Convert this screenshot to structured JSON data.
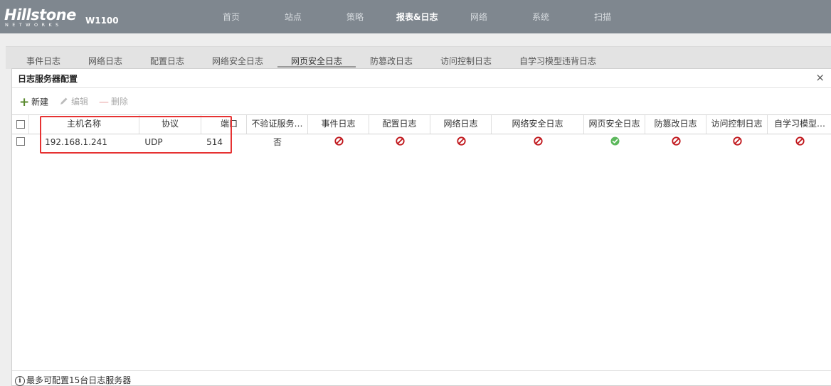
{
  "header": {
    "logo_text": "Hillstone",
    "logo_subtext": "NETWORKS",
    "model": "W1100",
    "nav": [
      "首页",
      "站点",
      "策略",
      "报表&日志",
      "网络",
      "系统",
      "扫描"
    ],
    "active_nav": "报表&日志"
  },
  "tabs": [
    "事件日志",
    "网络日志",
    "配置日志",
    "网络安全日志",
    "网页安全日志",
    "防篡改日志",
    "访问控制日志",
    "自学习模型违背日志"
  ],
  "active_tab": "网页安全日志",
  "panel": {
    "title": "日志服务器配置",
    "close_icon": "×"
  },
  "toolbar": {
    "new_label": "新建",
    "edit_label": "编辑",
    "delete_label": "删除"
  },
  "table": {
    "columns": [
      "主机名称",
      "协议",
      "端口",
      "不验证服务…",
      "事件日志",
      "配置日志",
      "网络日志",
      "网络安全日志",
      "网页安全日志",
      "防篡改日志",
      "访问控制日志",
      "自学习模型…"
    ],
    "rows": [
      {
        "host": "192.168.1.241",
        "protocol": "UDP",
        "port": "514",
        "no_verify": "否",
        "statuses": [
          "disabled",
          "disabled",
          "disabled",
          "disabled",
          "enabled",
          "disabled",
          "disabled",
          "disabled"
        ]
      }
    ]
  },
  "footer": {
    "note": "最多可配置15台日志服务器"
  },
  "colors": {
    "topbar": "#7f878f",
    "disabled_icon": "#c0161b",
    "enabled_icon": "#5cb85c",
    "highlight": "#e63232"
  }
}
